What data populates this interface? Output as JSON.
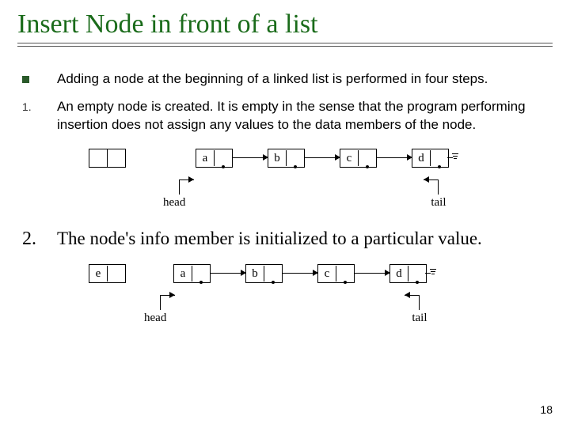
{
  "title": "Insert Node in front of a list",
  "bullets": [
    "Adding a node at the beginning of a linked list is performed in four steps.",
    "An empty node is created. It is empty in the sense that the program performing insertion does not assign any values to the data members of the node."
  ],
  "step2_marker": "2.",
  "step1_marker": "1.",
  "step2_text": "The node's info member is initialized to a particular value.",
  "labels": {
    "head": "head",
    "tail": "tail"
  },
  "nodes1": [
    "a",
    "b",
    "c",
    "d"
  ],
  "nodes2_e": "e",
  "nodes2": [
    "a",
    "b",
    "c",
    "d"
  ],
  "page_num": "18"
}
